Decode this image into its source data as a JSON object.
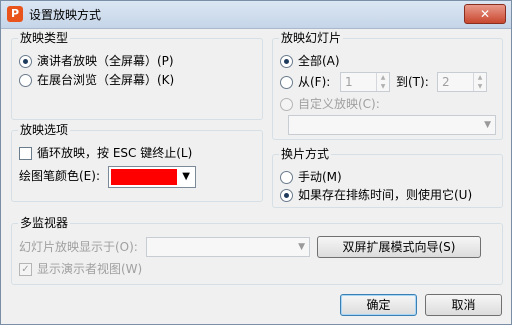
{
  "window": {
    "title": "设置放映方式",
    "app_icon_text": "P",
    "close_label": "✕"
  },
  "show_type": {
    "legend": "放映类型",
    "options": [
      {
        "label": "演讲者放映（全屏幕）(P)",
        "selected": true
      },
      {
        "label": "在展台浏览（全屏幕）(K)",
        "selected": false
      }
    ]
  },
  "show_options": {
    "legend": "放映选项",
    "loop_label": "循环放映，按 ESC 键终止(L)",
    "loop_checked": false,
    "pen_color_label": "绘图笔颜色(E):",
    "pen_color": "#ff0000"
  },
  "slides": {
    "legend": "放映幻灯片",
    "all_label": "全部(A)",
    "from_label": "从(F):",
    "from_value": "1",
    "to_label": "到(T):",
    "to_value": "2",
    "custom_label": "自定义放映(C):",
    "custom_value": "",
    "selected": "all"
  },
  "advance": {
    "legend": "换片方式",
    "options": [
      {
        "label": "手动(M)",
        "selected": false
      },
      {
        "label": "如果存在排练时间，则使用它(U)",
        "selected": true
      }
    ]
  },
  "monitors": {
    "legend": "多监视器",
    "display_on_label": "幻灯片放映显示于(O):",
    "display_on_value": "",
    "wizard_button": "双屏扩展模式向导(S)",
    "presenter_view_label": "显示演示者视图(W)",
    "presenter_view_checked": true
  },
  "footer": {
    "ok_label": "确定",
    "cancel_label": "取消"
  },
  "colors": {
    "accent": "#1e3b5e",
    "pen": "#ff0000"
  }
}
